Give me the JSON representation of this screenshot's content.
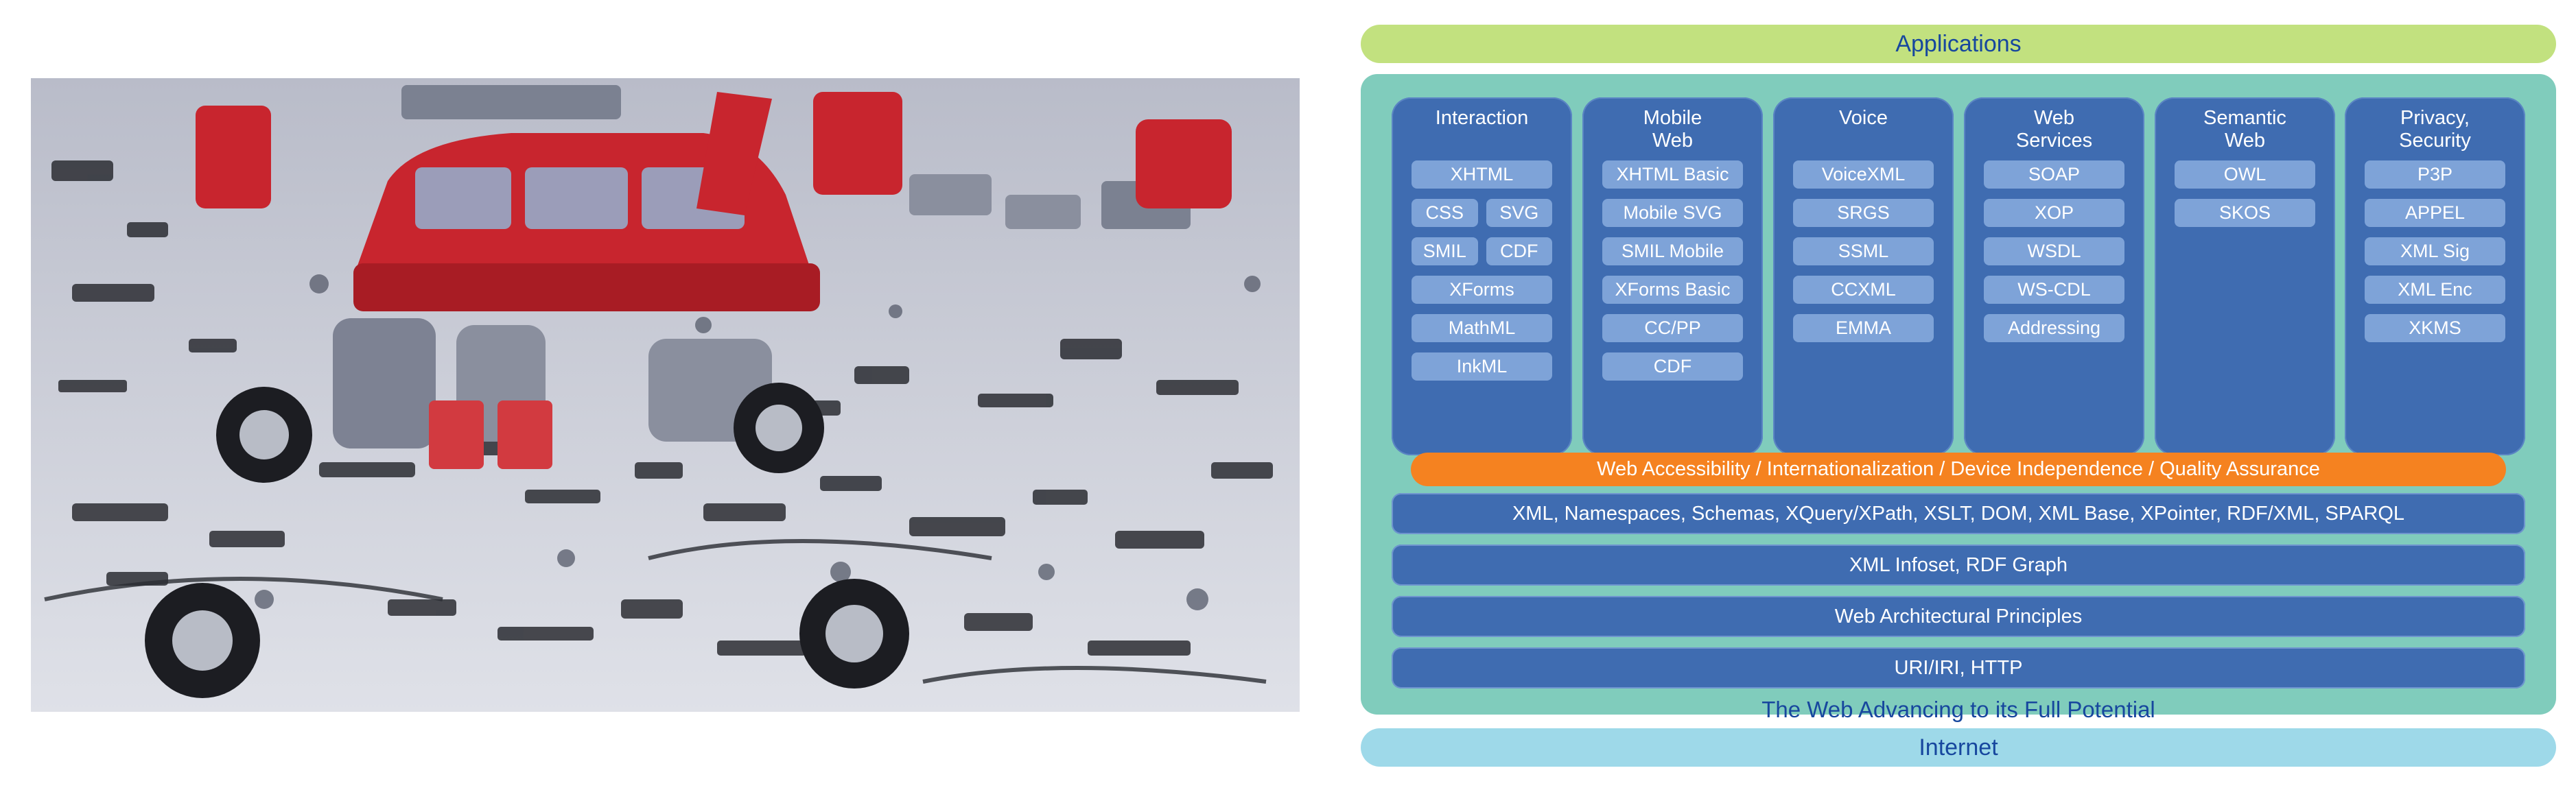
{
  "photo": {
    "subject": "disassembled-car-parts-photo"
  },
  "diagram": {
    "top_label": "Applications",
    "bottom_label": "Internet",
    "caption": "The Web Advancing to its Full Potential",
    "columns": [
      {
        "title": "Interaction",
        "chips": [
          "XHTML",
          "CSS",
          "SVG",
          "SMIL",
          "CDF",
          "XForms",
          "MathML",
          "InkML"
        ]
      },
      {
        "title": "Mobile\nWeb",
        "chips": [
          "XHTML Basic",
          "Mobile SVG",
          "SMIL Mobile",
          "XForms Basic",
          "CC/PP",
          "CDF"
        ]
      },
      {
        "title": "Voice",
        "chips": [
          "VoiceXML",
          "SRGS",
          "SSML",
          "CCXML",
          "EMMA"
        ]
      },
      {
        "title": "Web\nServices",
        "chips": [
          "SOAP",
          "XOP",
          "WSDL",
          "WS-CDL",
          "Addressing"
        ]
      },
      {
        "title": "Semantic\nWeb",
        "chips": [
          "OWL",
          "SKOS"
        ]
      },
      {
        "title": "Privacy,\nSecurity",
        "chips": [
          "P3P",
          "APPEL",
          "XML Sig",
          "XML Enc",
          "XKMS"
        ]
      }
    ],
    "accessibility": "Web Accessibility / Internationalization / Device Independence / Quality Assurance",
    "layers": [
      "XML, Namespaces, Schemas, XQuery/XPath, XSLT, DOM, XML Base, XPointer, RDF/XML, SPARQL",
      "XML Infoset, RDF Graph",
      "Web Architectural Principles",
      "URI/IRI, HTTP"
    ]
  },
  "colors": {
    "applications": "#c2e17f",
    "main_panel": "#80ccbc",
    "internet": "#9ed9e9",
    "column": "#3f6cb1",
    "chip": "#7ea3d8",
    "accessibility": "#f58220",
    "label_text": "#17479e"
  }
}
